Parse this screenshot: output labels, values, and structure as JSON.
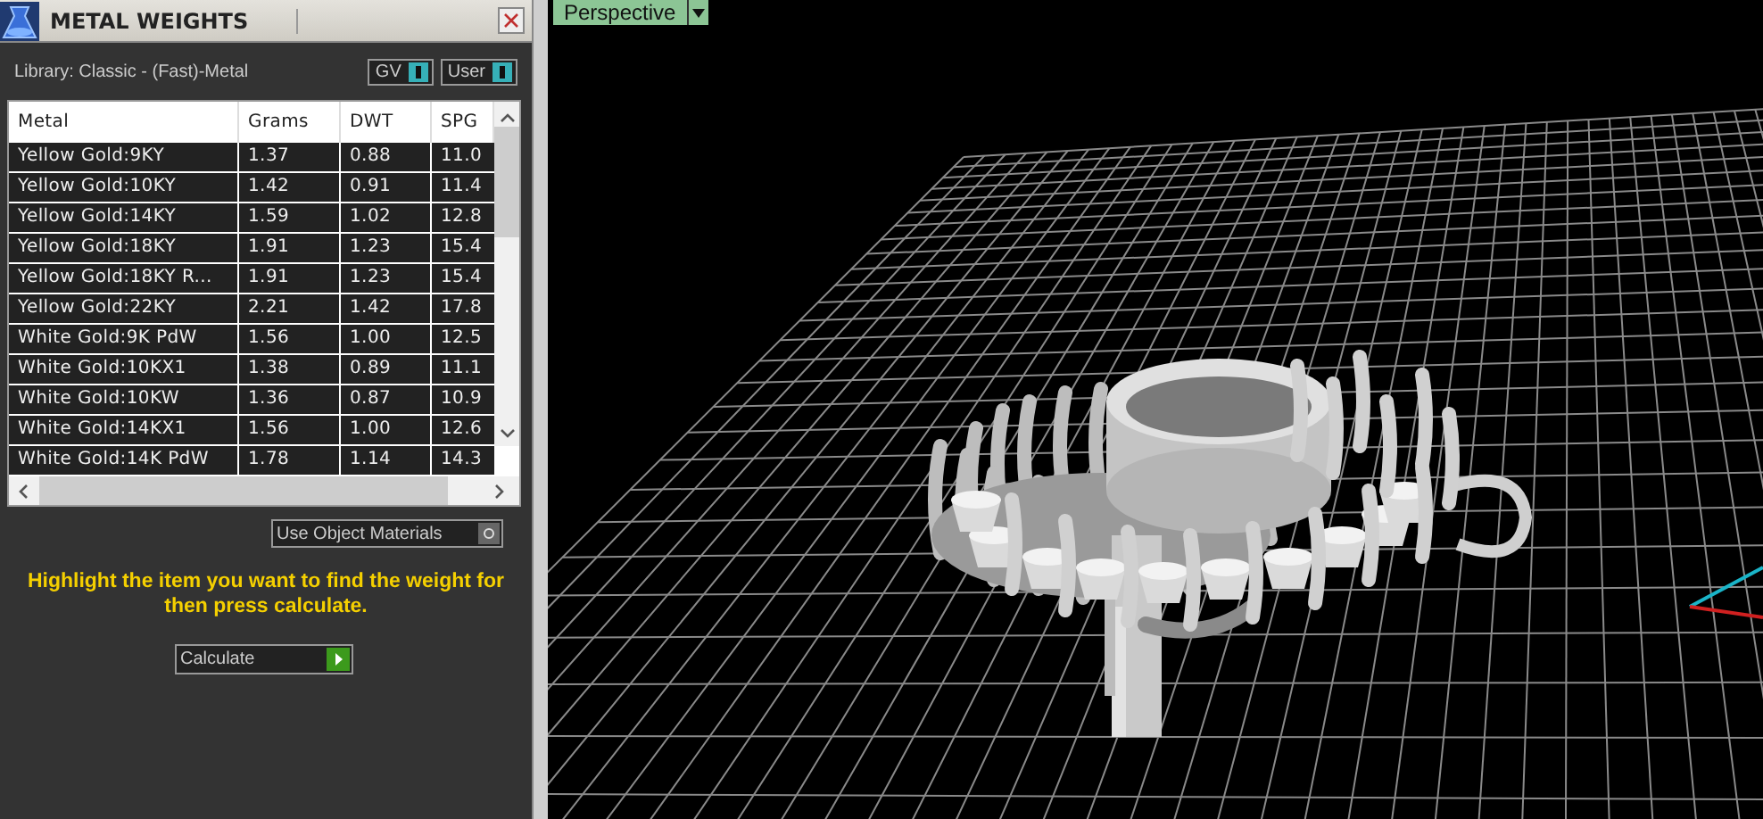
{
  "panel": {
    "title": "METAL WEIGHTS",
    "library": "Library: Classic - (Fast)-Metal",
    "toggles": [
      {
        "label": "GV",
        "on": true
      },
      {
        "label": "User",
        "on": true
      }
    ],
    "table": {
      "columns": [
        "Metal",
        "Grams",
        "DWT",
        "SPG"
      ],
      "rows": [
        [
          "Yellow Gold:9KY",
          "1.37",
          "0.88",
          "11.0"
        ],
        [
          "Yellow Gold:10KY",
          "1.42",
          "0.91",
          "11.4"
        ],
        [
          "Yellow Gold:14KY",
          "1.59",
          "1.02",
          "12.8"
        ],
        [
          "Yellow Gold:18KY",
          "1.91",
          "1.23",
          "15.4"
        ],
        [
          "Yellow Gold:18KY R...",
          "1.91",
          "1.23",
          "15.4"
        ],
        [
          "Yellow Gold:22KY",
          "2.21",
          "1.42",
          "17.8"
        ],
        [
          "White Gold:9K PdW",
          "1.56",
          "1.00",
          "12.5"
        ],
        [
          "White Gold:10KX1",
          "1.38",
          "0.89",
          "11.1"
        ],
        [
          "White Gold:10KW",
          "1.36",
          "0.87",
          "10.9"
        ],
        [
          "White Gold:14KX1",
          "1.56",
          "1.00",
          "12.6"
        ],
        [
          "White Gold:14K PdW",
          "1.78",
          "1.14",
          "14.3"
        ]
      ]
    },
    "use_object_materials": {
      "label": "Use Object Materials",
      "on": false
    },
    "hint": "Highlight the item you want to find the weight for then press calculate.",
    "calculate_button": "Calculate"
  },
  "viewport": {
    "view_tab": "Perspective"
  }
}
